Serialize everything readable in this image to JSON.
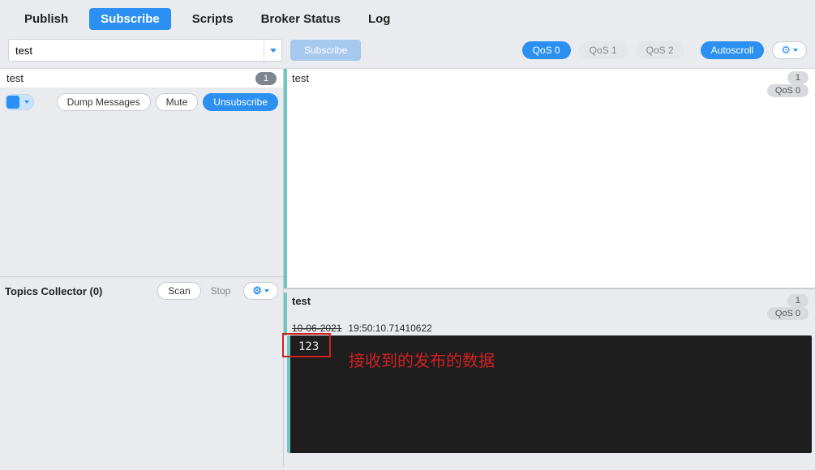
{
  "tabs": {
    "publish": "Publish",
    "subscribe": "Subscribe",
    "scripts": "Scripts",
    "broker_status": "Broker Status",
    "log": "Log"
  },
  "subscribe_bar": {
    "topic_value": "test",
    "subscribe_btn": "Subscribe",
    "qos0": "QoS 0",
    "qos1": "QoS 1",
    "qos2": "QoS 2",
    "autoscroll": "Autoscroll"
  },
  "subscription": {
    "topic": "test",
    "count": "1",
    "dump": "Dump Messages",
    "mute": "Mute",
    "unsubscribe": "Unsubscribe"
  },
  "collector": {
    "title": "Topics Collector (0)",
    "scan": "Scan",
    "stop": "Stop"
  },
  "right_topic": {
    "name": "test",
    "count": "1",
    "qos_tag": "QoS 0"
  },
  "message": {
    "topic": "test",
    "count": "1",
    "qos_tag": "QoS 0",
    "date": "10-06-2021",
    "time": "19:50:10.71410622",
    "payload": "123"
  },
  "annotation": {
    "text": "接收到的发布的数据"
  }
}
